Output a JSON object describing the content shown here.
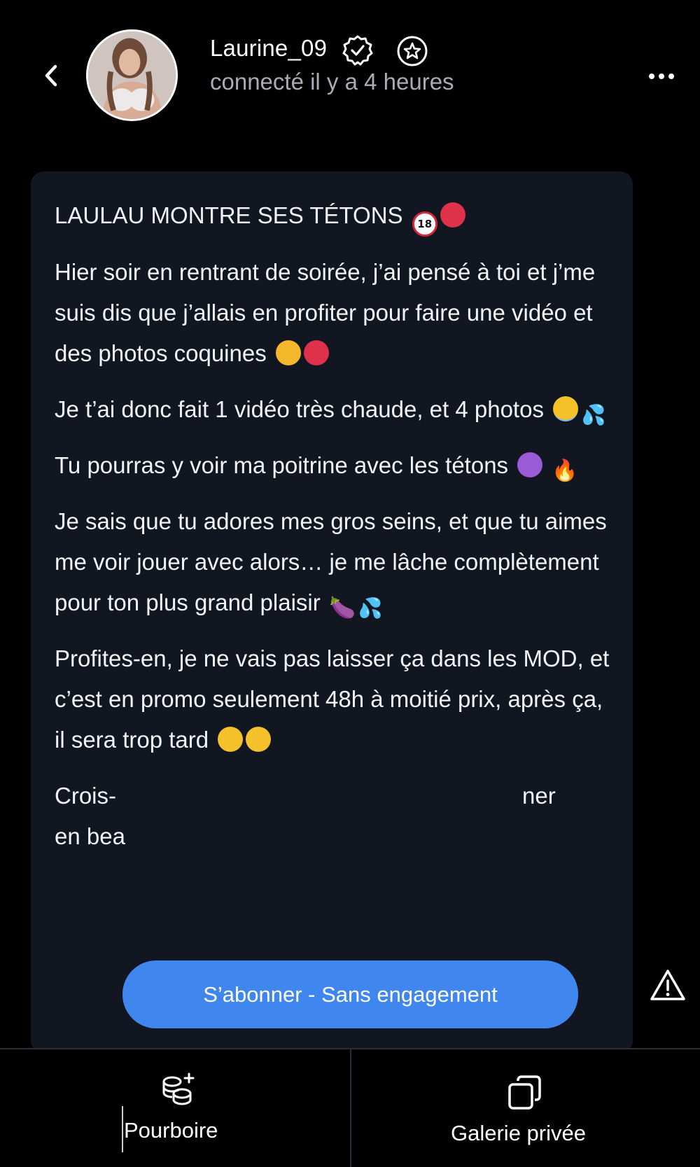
{
  "header": {
    "back_label": "<",
    "username": "Laurine_09",
    "status": "connecté il y a 4 heures",
    "more_label": "•••"
  },
  "post": {
    "title": "LAULAU MONTRE SES TÉTONS",
    "paragraphs": [
      "Hier soir en rentrant de soirée, j’ai pensé à toi et j’me suis dis que j’allais en profiter pour faire une vidéo et des photos coquines",
      "Je t’ai donc fait 1 vidéo très chaude, et 4 photos",
      "Tu pourras y voir ma poitrine avec les tétons",
      "Je sais que tu adores mes gros seins, et que tu aimes me voir jouer avec alors… je me lâche complètement pour ton plus grand plaisir",
      "Profites-en, je ne vais pas laisser ça dans les MOD, et c’est en promo seulement 48h à moitié prix, après ça, il sera trop tard",
      "Crois-",
      "ner",
      "en bea"
    ]
  },
  "subscribe_button": "S’abonner - Sans engagement",
  "bottom_bar": {
    "tip_label": "Pourboire",
    "gallery_label": "Galerie privée"
  },
  "colors": {
    "background": "#000000",
    "card": "#121620",
    "accent": "#3f86ee",
    "muted_text": "#a9acb4"
  },
  "icons": {
    "back": "chevron-left-icon",
    "verified": "verified-badge-icon",
    "favorite": "star-icon",
    "more": "more-dots-icon",
    "report": "warning-icon",
    "tip": "coins-plus-icon",
    "gallery": "gallery-copy-icon"
  }
}
